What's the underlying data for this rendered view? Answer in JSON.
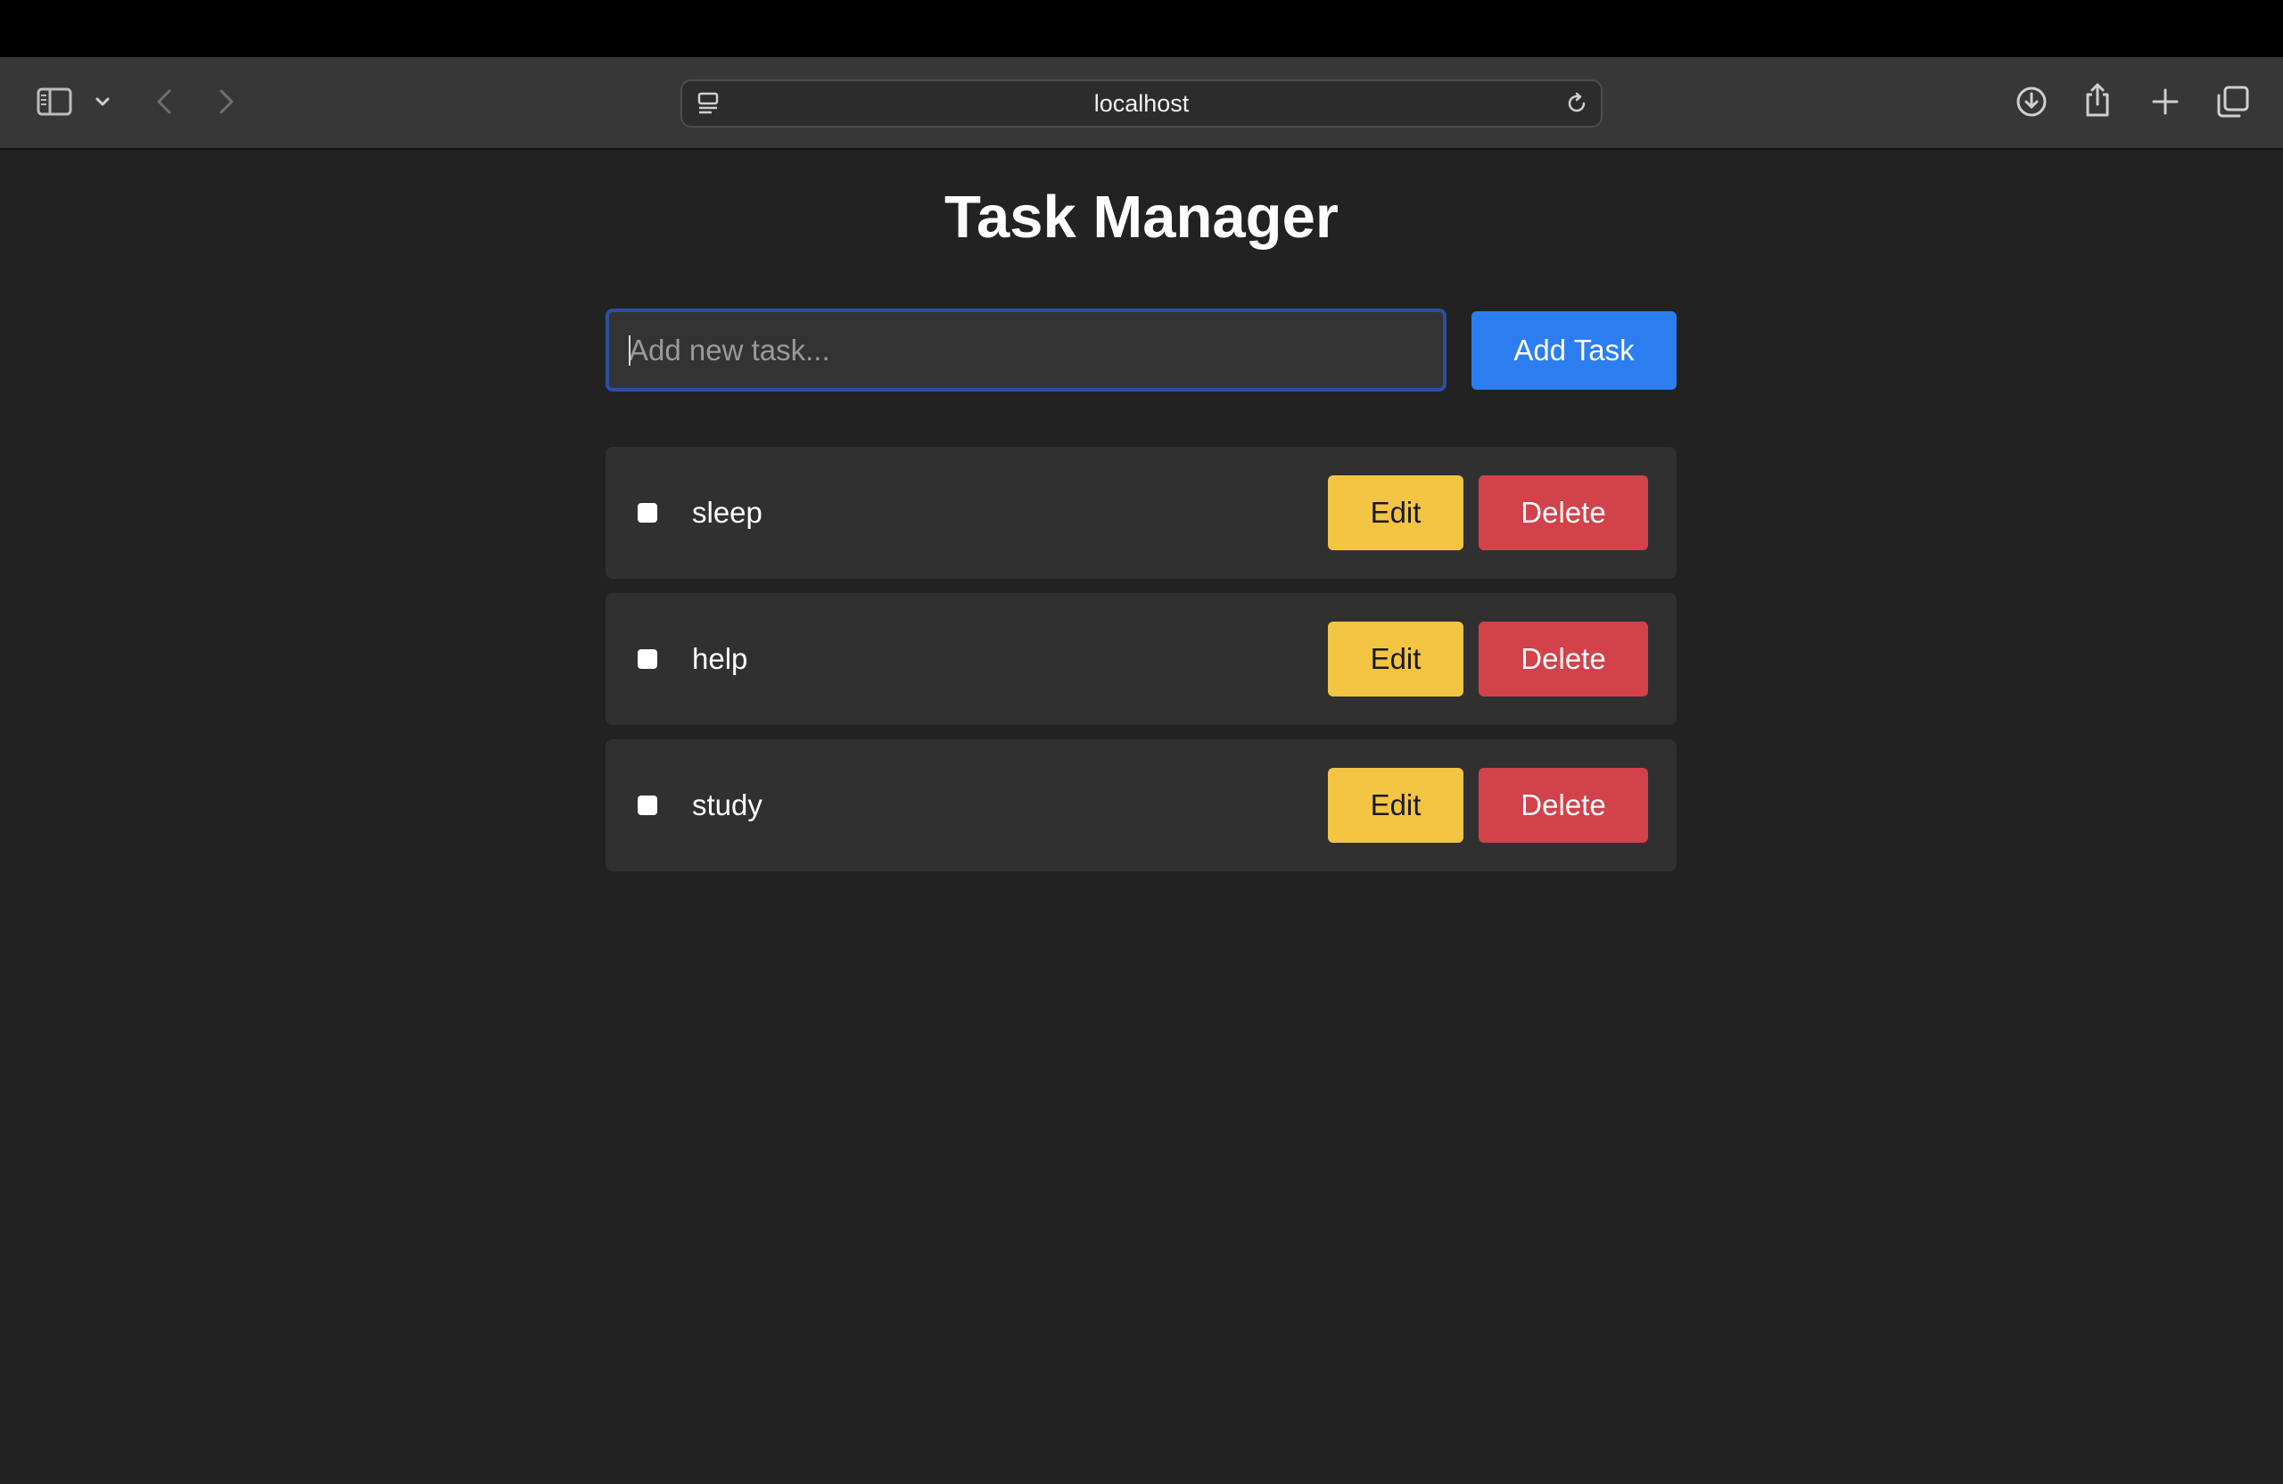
{
  "browser": {
    "url": "localhost",
    "icons": {
      "sidebar": "sidebar-icon",
      "sidebar_menu": "chevron-down-icon",
      "back": "chevron-left-icon",
      "forward": "chevron-right-icon",
      "page_menu": "page-menu-icon",
      "reload": "reload-icon",
      "downloads": "download-icon",
      "share": "share-icon",
      "new_tab": "plus-icon",
      "tab_overview": "tabs-icon"
    }
  },
  "app": {
    "title": "Task Manager",
    "input": {
      "placeholder": "Add new task...",
      "value": ""
    },
    "add_button_label": "Add Task",
    "tasks": [
      {
        "label": "sleep",
        "done": false,
        "edit_label": "Edit",
        "delete_label": "Delete"
      },
      {
        "label": "help",
        "done": false,
        "edit_label": "Edit",
        "delete_label": "Delete"
      },
      {
        "label": "study",
        "done": false,
        "edit_label": "Edit",
        "delete_label": "Delete"
      }
    ]
  },
  "colors": {
    "background": "#222222",
    "task_row": "#303030",
    "accent_blue": "#2c7ef0",
    "edit_yellow": "#f4c443",
    "delete_red": "#d2424a"
  }
}
